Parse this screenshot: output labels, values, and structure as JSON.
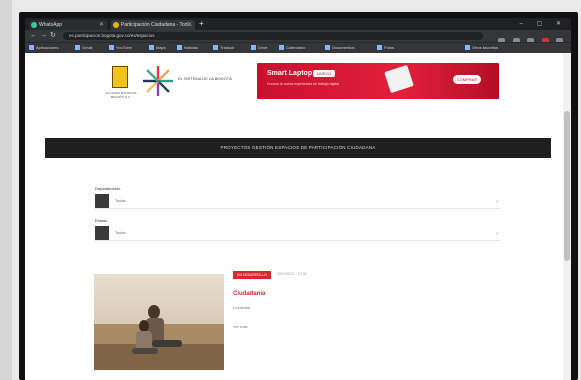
{
  "browser": {
    "tabs": [
      {
        "label": "WhatsApp",
        "active": false
      },
      {
        "label": "Participación Ciudadana - Tod...",
        "active": true
      }
    ],
    "new_tab": "+",
    "window_controls": "–  ▢  ✕",
    "url": "es.participacion.bogota.gov.co/es/espacios",
    "nav": {
      "back": "←",
      "forward": "→",
      "reload": "↻"
    },
    "bookmarks": [
      "Aplicaciones",
      "Gmail",
      "YouTube",
      "Maps",
      "Noticias",
      "Traducir",
      "Drive",
      "Calendario",
      "Documentos",
      "Fotos",
      "Otros favoritos"
    ]
  },
  "header": {
    "crest_caption": "ALCALDÍA MAYOR DE BOGOTÁ D.C.",
    "logo_text": "EL SISTEMA DE LA BOGOTÁ",
    "banner": {
      "title": "Smart Laptop",
      "badge": "NUEVO",
      "subtitle": "Conoce la nueva experiencia de trabajo digital",
      "cta": "COMPRAR"
    }
  },
  "main": {
    "page_title": "PROYECTOS GESTIÓN ESPACIOS DE PARTICIPACIÓN CIUDADANA",
    "filters": [
      {
        "label": "Departamento",
        "value": "Todas"
      },
      {
        "label": "Estado",
        "value": "Todos"
      }
    ],
    "card": {
      "tag": "EN DESARROLLO",
      "date": "20/10/2021 - 10:30",
      "title": "Ciudadanía",
      "subtitle": "Localidad",
      "more": "Ver más"
    }
  },
  "colors": {
    "accent": "#d7282f",
    "title_bar": "#1f1f1f",
    "browser_dark": "#202124"
  }
}
